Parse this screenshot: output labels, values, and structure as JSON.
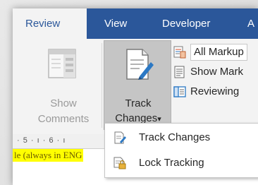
{
  "tabs": [
    {
      "label": "Review",
      "active": true
    },
    {
      "label": "View",
      "active": false
    },
    {
      "label": "Developer",
      "active": false
    },
    {
      "label": "A",
      "active": false
    }
  ],
  "ribbon": {
    "show_comments": {
      "line1": "Show",
      "line2": "Comments",
      "enabled": false
    },
    "track_changes": {
      "line1": "Track",
      "line2": "Changes",
      "dropdown_glyph": "▾",
      "pressed": true
    },
    "markup": {
      "all_markup": "All Markup",
      "show_markup": "Show Mark",
      "reviewing": "Reviewing"
    }
  },
  "ruler": {
    "text": "· 5 · ı · 6 · ı"
  },
  "document": {
    "visible_text": "le (always in ENG"
  },
  "dropdown_menu": {
    "items": [
      {
        "label": "Track Changes",
        "icon": "track-changes-icon"
      },
      {
        "label": "Lock Tracking",
        "icon": "lock-tracking-icon"
      }
    ]
  },
  "colors": {
    "tab_bar": "#2b579a",
    "ribbon_bg": "#f3f3f3",
    "pressed_button": "#c5c5c5",
    "highlight": "#ffff00"
  }
}
